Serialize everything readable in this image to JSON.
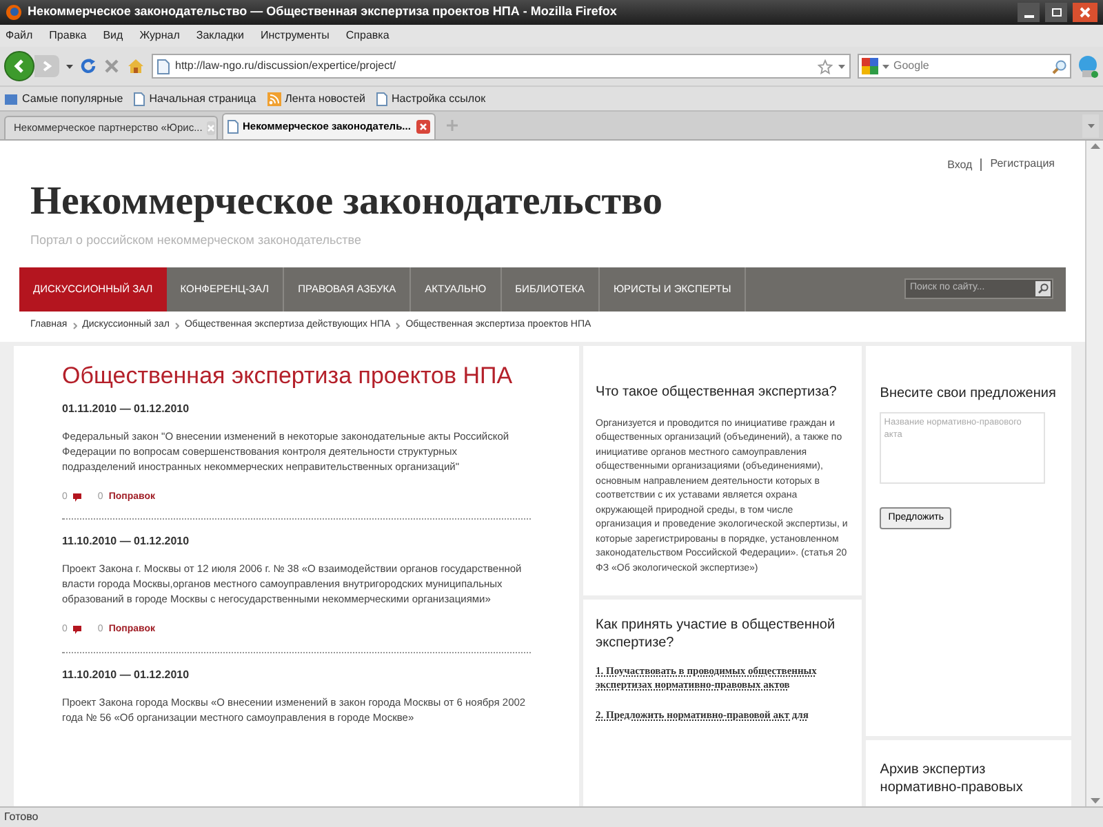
{
  "window": {
    "title": "Некоммерческое законодательство — Общественная экспертиза проектов НПА - Mozilla Firefox"
  },
  "menu": [
    "Файл",
    "Правка",
    "Вид",
    "Журнал",
    "Закладки",
    "Инструменты",
    "Справка"
  ],
  "toolbar": {
    "url": "http://law-ngo.ru/discussion/expertice/project/",
    "search_placeholder": "Google"
  },
  "bookmarks": [
    {
      "kind": "smart",
      "label": "Самые популярные"
    },
    {
      "kind": "page",
      "label": "Начальная страница"
    },
    {
      "kind": "feed",
      "label": "Лента новостей"
    },
    {
      "kind": "page",
      "label": "Настройка ссылок"
    }
  ],
  "tabs": [
    {
      "label": "Некоммерческое партнерство «Юрис...",
      "selected": false
    },
    {
      "label": "Некоммерческое законодатель...",
      "selected": true
    }
  ],
  "page": {
    "user_links": [
      "Вход",
      "Регистрация"
    ],
    "site_title": "Некоммерческое законодательство",
    "site_subtitle": "Портал о российском некоммерческом законодательстве",
    "nav": [
      {
        "label": "ДИСКУССИОННЫЙ ЗАЛ",
        "selected": true
      },
      {
        "label": "КОНФЕРЕНЦ-ЗАЛ",
        "selected": false
      },
      {
        "label": "ПРАВОВАЯ АЗБУКА",
        "selected": false
      },
      {
        "label": "АКТУАЛЬНО",
        "selected": false
      },
      {
        "label": "БИБЛИОТЕКА",
        "selected": false
      },
      {
        "label": "ЮРИСТЫ И ЭКСПЕРТЫ",
        "selected": false
      }
    ],
    "site_search": {
      "placeholder": "Поиск по сайту..."
    },
    "breadcrumbs": [
      "Главная",
      "Дискуссионный зал",
      "Общественная экспертиза действующих НПА",
      "Общественная экспертиза проектов НПА"
    ],
    "heading": "Общественная экспертиза проектов НПА",
    "projects": [
      {
        "dates": "01.11.2010 — 01.12.2010",
        "text": "Федеральный закон \"О внесении изменений в некоторые законодательные акты Российской Федерации по вопросам совершенствования контроля деятельности структурных подразделений иностранных некоммерческих неправительственных организаций\"",
        "comments": "0",
        "amendments_count": "0",
        "amendments_label": "Поправок"
      },
      {
        "dates": "11.10.2010 — 01.12.2010",
        "text": "Проект Закона г. Москвы от 12 июля 2006 г. № 38 «О взаимодействии органов государственной власти города Москвы,органов местного самоуправления внутригородских муниципальных образований в городе Москвы с негосударственными некоммерческими организациями»",
        "comments": "0",
        "amendments_count": "0",
        "amendments_label": "Поправок"
      },
      {
        "dates": "11.10.2010 — 01.12.2010",
        "text": "Проект Закона города Москвы «О внесении изменений в закон города Москвы от 6 ноября 2002 года № 56 «Об организации местного самоуправления в городе Москве»"
      }
    ],
    "info": {
      "heading": "Что такое общественная экспертиза?",
      "text": "Организуется и проводится по инициативе граждан и общественных организаций (объединений), а также по инициативе органов местного самоуправления общественными организациями (объединениями), основным направлением деятельности которых в соответствии с их уставами является охрана окружающей природной среды, в том числе организация и проведение экологической экспертизы, и которые зарегистрированы в порядке, установленном законодательством Российской Федерации». (статья 20 ФЗ «Об экологической экспертизе»)"
    },
    "participate": {
      "heading": "Как принять участие в общественной экспертизе?",
      "steps": [
        "1. Поучаствовать в проводимых общественных экспертизах нормативно-правовых актов",
        "2. Предложить нормативно-правовой акт для"
      ]
    },
    "proposal": {
      "heading": "Внесите свои предложения",
      "placeholder": "Название нормативно-правового акта",
      "button": "Предложить"
    },
    "archive": {
      "heading": "Архив экспертиз нормативно-правовых"
    }
  },
  "status_bar": "Готово"
}
